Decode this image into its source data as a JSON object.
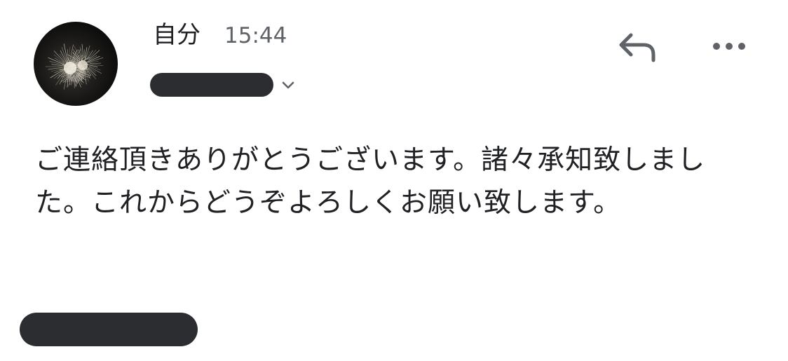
{
  "header": {
    "sender_name": "自分",
    "time": "15:44",
    "avatar_icon": "fireworks-photo",
    "reply_icon": "reply-arrow-icon",
    "more_icon": "more-horizontal-icon",
    "chevron_icon": "chevron-down-icon"
  },
  "message": {
    "body": "ご連絡頂きありがとうございます。諸々承知致しました。これからどうぞよろしくお願い致します。"
  },
  "colors": {
    "text_primary": "#202124",
    "text_secondary": "#5f6368",
    "icon": "#5f6368",
    "redaction": "#2b2d31",
    "background": "#ffffff"
  }
}
